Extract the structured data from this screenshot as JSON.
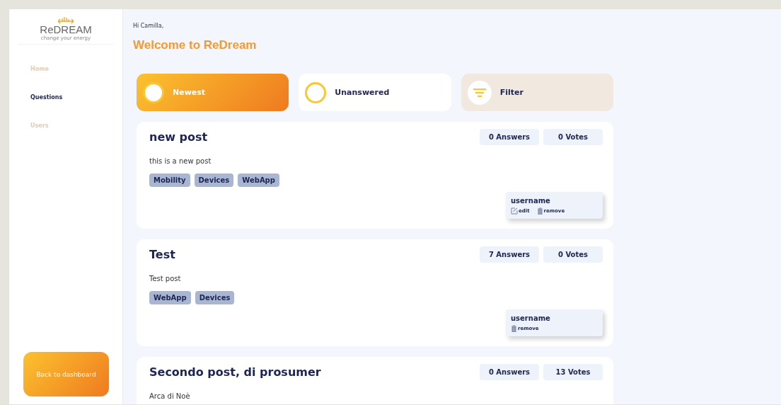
{
  "brand": {
    "name": "ReDREAM",
    "tagline": "change your energy"
  },
  "sidebar": {
    "items": [
      {
        "label": "Home",
        "selected": false
      },
      {
        "label": "Questions",
        "selected": true
      },
      {
        "label": "Users",
        "selected": false
      }
    ],
    "back_button": "Back to dashboard"
  },
  "greeting": "Hi Camilla,",
  "heading": "Welcome to ReDream",
  "tabs": [
    {
      "kind": "sort",
      "label": "Newest",
      "selected": true
    },
    {
      "kind": "sort",
      "label": "Unanswered",
      "selected": false
    },
    {
      "kind": "filter",
      "label": "Filter",
      "selected": false
    }
  ],
  "posts": [
    {
      "title": "new post",
      "answers": "0 Answers",
      "votes": "0 Votes",
      "body": "this is a new post",
      "tags": [
        "Mobility",
        "Devices",
        "WebApp"
      ],
      "author": {
        "name": "username",
        "actions": [
          {
            "kind": "edit",
            "label": "edit"
          },
          {
            "kind": "remove",
            "label": "remove"
          }
        ]
      }
    },
    {
      "title": "Test",
      "answers": "7 Answers",
      "votes": "0 Votes",
      "body": "Test post",
      "tags": [
        "WebApp",
        "Devices"
      ],
      "author": {
        "name": "username",
        "actions": [
          {
            "kind": "remove",
            "label": "remove"
          }
        ]
      }
    },
    {
      "title": "Secondo post, di prosumer",
      "answers": "0 Answers",
      "votes": "13 Votes",
      "body": "Arca di Noè"
    }
  ]
}
